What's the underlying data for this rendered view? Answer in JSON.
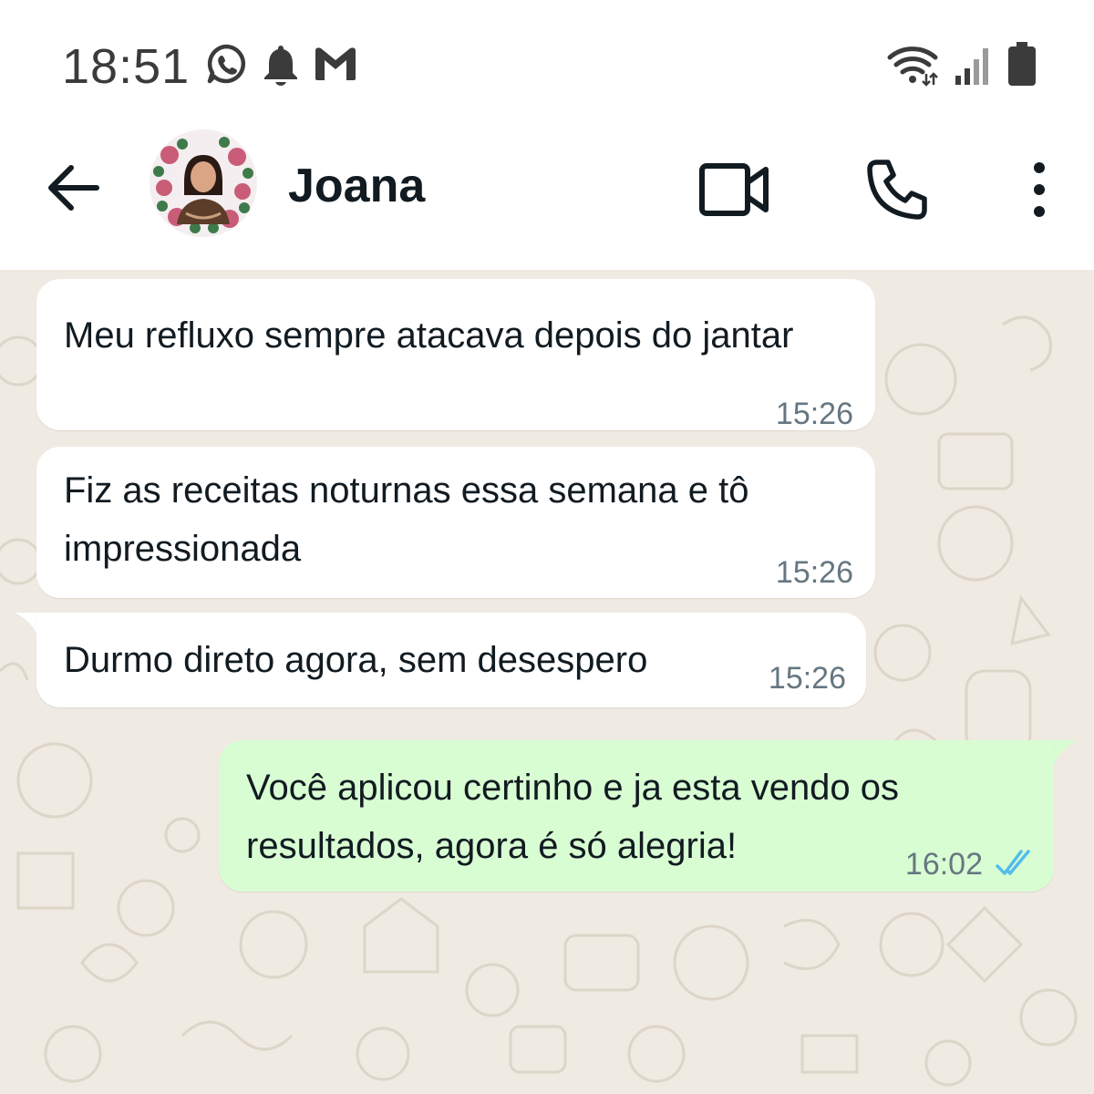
{
  "status_bar": {
    "time": "18:51",
    "left_icons": [
      "whatsapp-icon",
      "notification-bell-icon",
      "gmail-icon"
    ],
    "right_icons": [
      "wifi-icon",
      "signal-icon",
      "battery-icon"
    ]
  },
  "header": {
    "contact_name": "Joana",
    "icons": [
      "back-arrow-icon",
      "avatar",
      "video-camera-icon",
      "phone-icon",
      "more-vertical-icon"
    ]
  },
  "messages": [
    {
      "direction": "incoming",
      "text": "Meu refluxo sempre atacava depois do jantar",
      "time": "15:26"
    },
    {
      "direction": "incoming",
      "text": "Fiz as receitas noturnas essa semana e tô impressionada",
      "time": "15:26"
    },
    {
      "direction": "incoming",
      "text": "Durmo direto agora, sem desespero",
      "time": "15:26"
    },
    {
      "direction": "outgoing",
      "text": "Você aplicou certinho e ja esta vendo os resultados, agora é só alegria!",
      "time": "16:02",
      "status": "read"
    }
  ],
  "colors": {
    "chat_background": "#efeae2",
    "incoming_bubble": "#ffffff",
    "outgoing_bubble": "#d9fdd3",
    "read_receipt": "#53bdeb",
    "timestamp": "#667781"
  }
}
